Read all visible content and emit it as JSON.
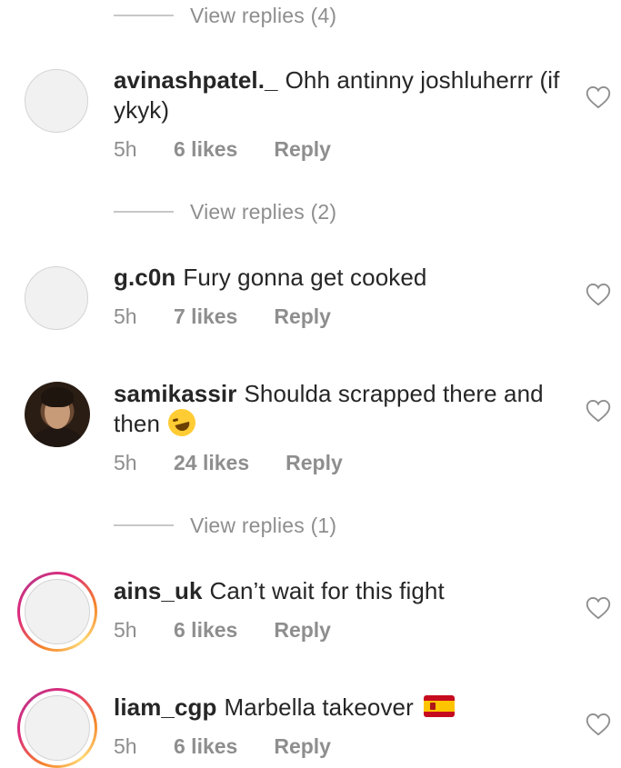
{
  "view_replies": [
    {
      "label": "View replies (4)"
    },
    {
      "label": "View replies (2)"
    },
    {
      "label": "View replies (1)"
    }
  ],
  "comments": [
    {
      "username": "avinashpatel._",
      "text": "Ohh antinny joshluherrr (if ykyk)",
      "time": "5h",
      "likes": "6 likes",
      "reply": "Reply",
      "avatar": "placeholder"
    },
    {
      "username": "g.c0n",
      "text": "Fury gonna get cooked",
      "time": "5h",
      "likes": "7 likes",
      "reply": "Reply",
      "avatar": "placeholder"
    },
    {
      "username": "samikassir",
      "text": "Shoulda scrapped there and then",
      "emoji": "rolling-on-floor-laughing-emoji",
      "time": "5h",
      "likes": "24 likes",
      "reply": "Reply",
      "avatar": "photo"
    },
    {
      "username": "ains_uk",
      "text": "Can’t wait for this fight",
      "time": "5h",
      "likes": "6 likes",
      "reply": "Reply",
      "avatar": "story-ring"
    },
    {
      "username": "liam_cgp",
      "text": "Marbella takeover",
      "emoji": "spain-flag-emoji",
      "time": "5h",
      "likes": "6 likes",
      "reply": "Reply",
      "avatar": "story-ring"
    }
  ],
  "icons": {
    "like": "heart-outline-icon"
  },
  "colors": {
    "text": "#262626",
    "muted": "#8e8e8e",
    "ring_start": "#f58529",
    "ring_end": "#dd2a7b"
  }
}
